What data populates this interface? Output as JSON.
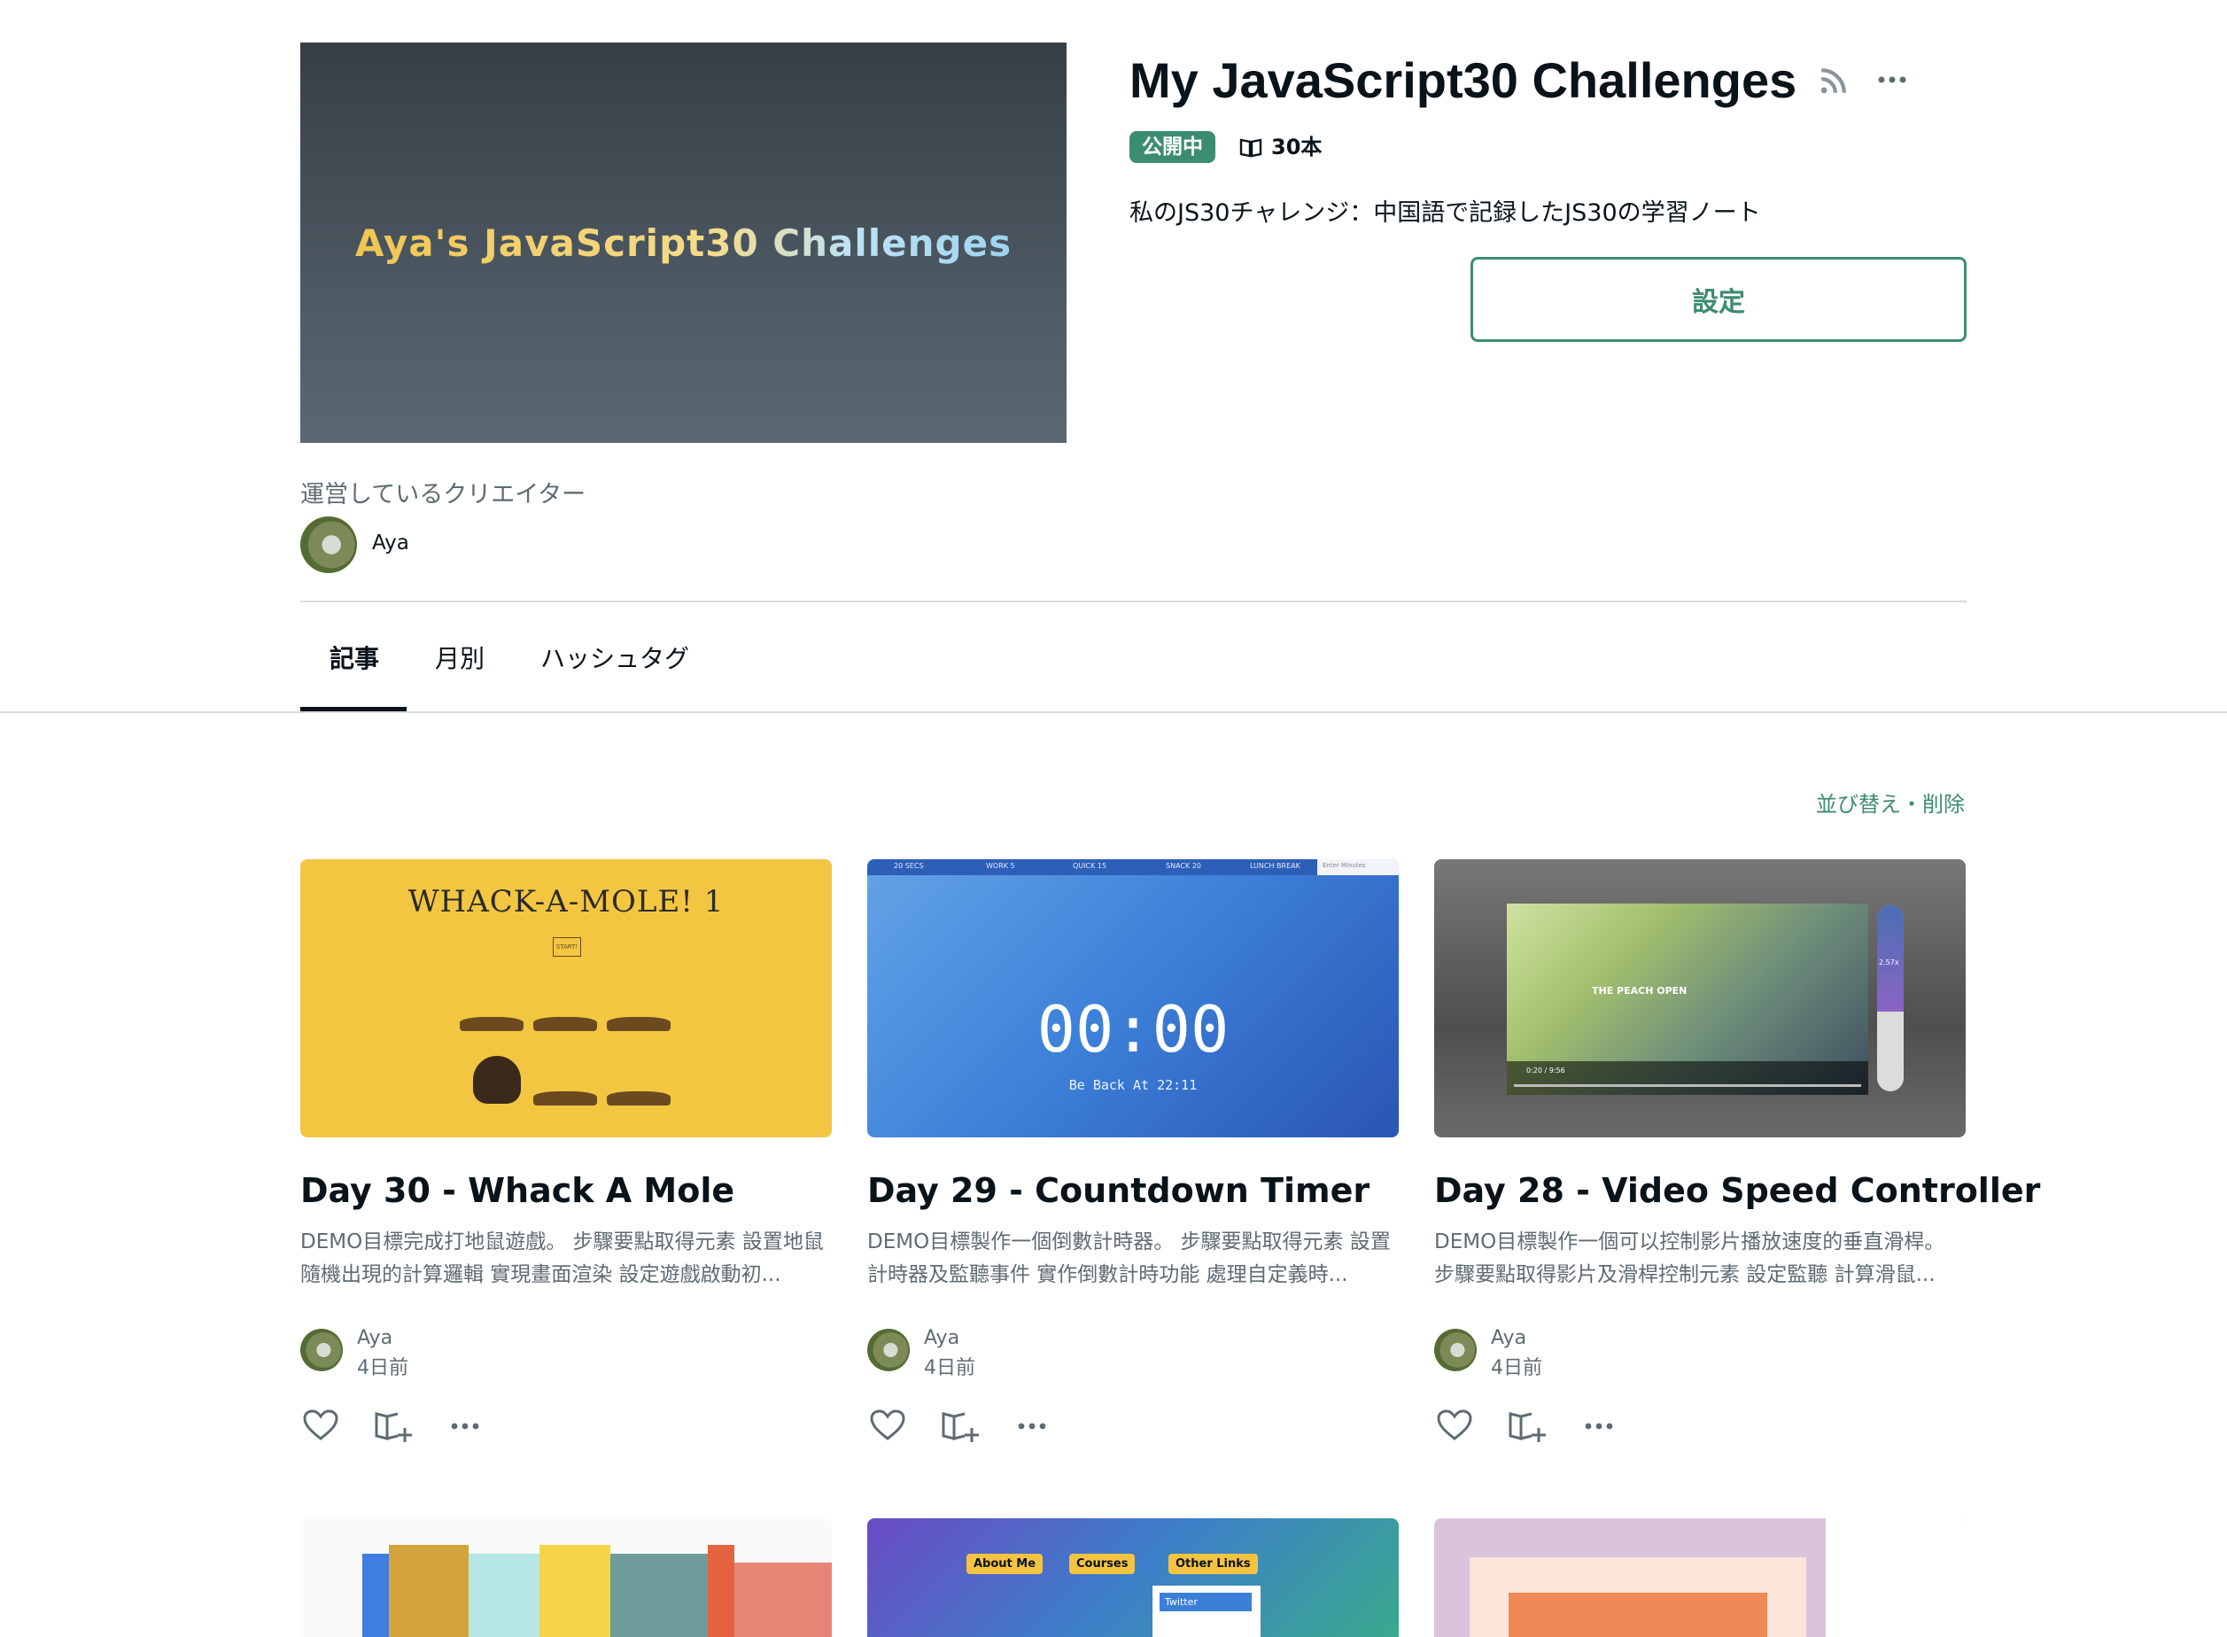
{
  "header": {
    "cover_title": "Aya's JavaScript30 Challenges",
    "title": "My JavaScript30 Challenges",
    "status_badge": "公開中",
    "article_count": "30本",
    "description": "私のJS30チャレンジ：中国語で記録したJS30の学習ノート",
    "settings_label": "設定",
    "creator_label": "運営しているクリエイター",
    "creator_name": "Aya"
  },
  "tabs": [
    {
      "label": "記事",
      "active": true
    },
    {
      "label": "月別",
      "active": false
    },
    {
      "label": "ハッシュタグ",
      "active": false
    }
  ],
  "sort_label": "並び替え・削除",
  "cards": [
    {
      "title": "Day 30 - Whack A Mole",
      "excerpt": "DEMO目標完成打地鼠遊戲。 步驟要點取得元素 設置地鼠隨機出現的計算邏輯 實現畫面渲染 設定遊戲啟動初...",
      "author": "Aya",
      "date": "4日前",
      "thumb_title": "WHACK-A-MOLE! 1",
      "thumb_button": "START!"
    },
    {
      "title": "Day 29 - Countdown Timer",
      "excerpt": "DEMO目標製作一個倒數計時器。 步驟要點取得元素 設置計時器及監聽事件 實作倒數計時功能 處理自定義時...",
      "author": "Aya",
      "date": "4日前",
      "thumb_bar": [
        "20 SECS",
        "WORK 5",
        "QUICK 15",
        "SNACK 20",
        "LUNCH BREAK",
        "Enter Minutes"
      ],
      "thumb_digits": "00:00",
      "thumb_sub": "Be Back At 22:11"
    },
    {
      "title": "Day 28 - Video Speed Controller",
      "excerpt": "DEMO目標製作一個可以控制影片播放速度的垂直滑桿。 步驟要點取得影片及滑桿控制元素 設定監聽 計算滑鼠...",
      "author": "Aya",
      "date": "4日前",
      "thumb_video_text": "THE PEACH OPEN",
      "thumb_time": "0:20 / 9:56",
      "thumb_speed": "2.57x",
      "speed_fraction": 0.57
    }
  ],
  "next_row": {
    "nav_links": [
      "About Me",
      "Courses",
      "Other Links"
    ],
    "nav_dropdown": "Twitter"
  },
  "colors": {
    "accent": "#3c8c72",
    "text": "#08131a",
    "muted": "#5f6b72"
  },
  "icons": [
    "rss-icon",
    "more-icon",
    "book-icon",
    "heart-icon",
    "magazine-add-icon"
  ]
}
